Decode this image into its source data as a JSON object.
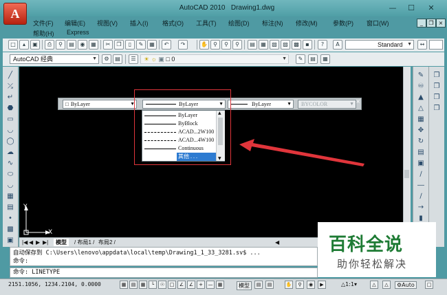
{
  "window": {
    "title": "AutoCAD 2010",
    "document": "Drawing1.dwg",
    "app_logo_letter": "A"
  },
  "menu": {
    "row1": [
      "文件(F)",
      "编辑(E)",
      "视图(V)",
      "插入(I)",
      "格式(O)",
      "工具(T)",
      "绘图(D)",
      "标注(N)",
      "修改(M)",
      "参数(P)",
      "窗口(W)"
    ],
    "row2": [
      "帮助(H)",
      "Express"
    ]
  },
  "toolbar": {
    "text_style": "Standard",
    "workspace": "AutoCAD 经典",
    "layer": "0"
  },
  "properties_toolbar": {
    "color": "ByLayer",
    "linetype": "ByLayer",
    "lineweight": "ByLayer",
    "plotstyle": "BYCOLOR"
  },
  "linetype_dropdown": {
    "options": [
      "ByLayer",
      "ByBlock",
      "ACAD...2W100",
      "ACAD...4W100",
      "Continuous",
      "其他 . . ."
    ],
    "selected": "其他 . . ."
  },
  "ucs": {
    "x_label": "X",
    "y_label": "Y"
  },
  "tabs": [
    "模型",
    "布局1",
    "布局2"
  ],
  "command": {
    "history1": "自动保存到 C:\\Users\\lenovo\\appdata\\local\\temp\\Drawing1_1_33_3281.sv$ ...",
    "history2": "命令:",
    "current": "命令: LINETYPE"
  },
  "status": {
    "coordinates": "2151.1056,  1234.2104,  0.0000",
    "model_label": "模型",
    "scale": "1:1",
    "auto": "Auto"
  },
  "watermark": {
    "title": "百科全说",
    "subtitle": "助你轻松解决"
  },
  "colors": {
    "accent_red": "#e0353b",
    "selection_blue": "#2d7bd1",
    "canvas": "#000000"
  }
}
